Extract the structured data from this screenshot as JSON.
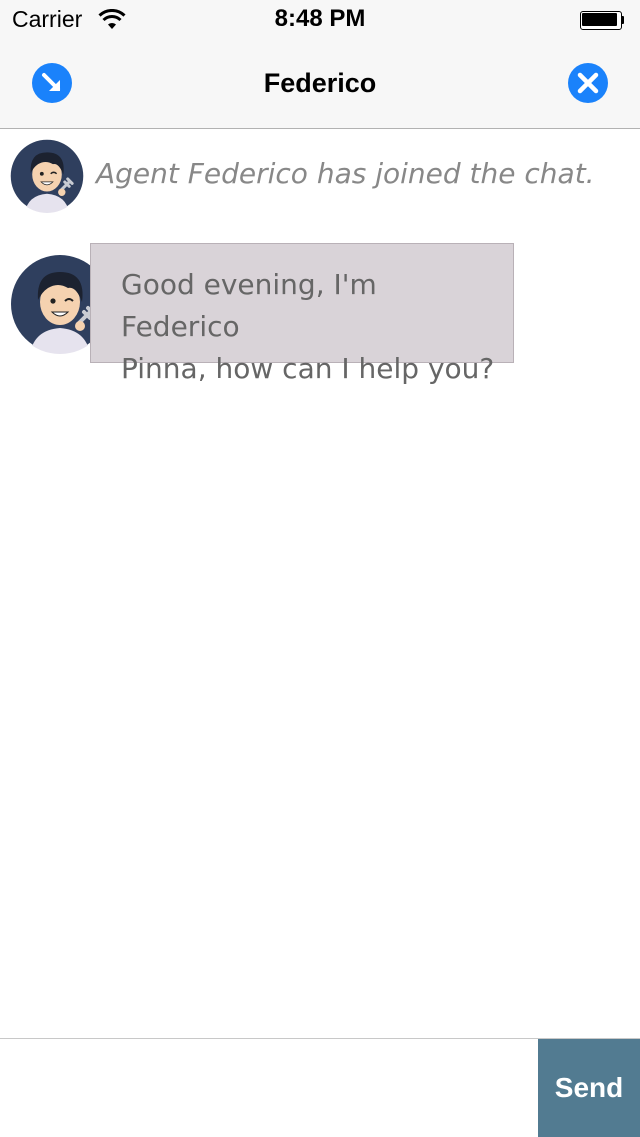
{
  "status_bar": {
    "carrier": "Carrier",
    "time": "8:48 PM",
    "wifi_icon": "wifi-icon",
    "battery_icon": "battery-icon"
  },
  "nav": {
    "title": "Federico",
    "left_icon": "arrow-down-right-icon",
    "right_icon": "close-icon",
    "accent_color": "#1a82fb"
  },
  "chat": {
    "system_message": "Agent Federico has joined the chat.",
    "agent_message_line1": "Good evening, I'm Federico",
    "agent_message_line2": "Pinna, how can I help you?",
    "bubble_color": "#d9d3d8"
  },
  "composer": {
    "input_value": "",
    "send_label": "Send",
    "send_color": "#527b91"
  }
}
